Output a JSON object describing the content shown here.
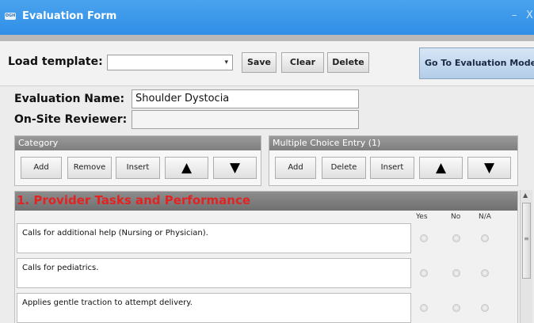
{
  "window": {
    "title": "Evaluation Form",
    "icon_text": "OGH",
    "minimize_glyph": "–",
    "close_glyph": "X"
  },
  "toolbar": {
    "load_template_label": "Load template:",
    "template_value": "",
    "select_caret": "▾",
    "save_label": "Save",
    "clear_label": "Clear",
    "delete_label": "Delete",
    "eval_mode_label": "Go To Evaluation Mode"
  },
  "form": {
    "evaluation_name_label": "Evaluation Name:",
    "evaluation_name_value": "Shoulder Dystocia",
    "reviewer_label": "On-Site Reviewer:",
    "reviewer_value": ""
  },
  "category_panel": {
    "header": "Category",
    "add_label": "Add",
    "remove_label": "Remove",
    "insert_label": "Insert",
    "up_glyph": "▲",
    "down_glyph": "▼"
  },
  "mc_panel": {
    "header": "Multiple Choice Entry (1)",
    "add_label": "Add",
    "delete_label": "Delete",
    "insert_label": "Insert",
    "up_glyph": "▲",
    "down_glyph": "▼"
  },
  "list": {
    "category_title": "1. Provider Tasks and Performance",
    "columns": {
      "yes": "Yes",
      "no": "No",
      "na": "N/A"
    },
    "questions": [
      {
        "text": "Calls for additional help (Nursing or Physician)."
      },
      {
        "text": "Calls for pediatrics."
      },
      {
        "text": "Applies gentle traction to attempt delivery."
      }
    ]
  },
  "scrollbar": {
    "up_glyph": "▲",
    "grip_glyph": "≡"
  },
  "colors": {
    "titlebar": "#2f8ee6",
    "category_title": "#e32222",
    "panel_header": "#7e7e7e"
  }
}
